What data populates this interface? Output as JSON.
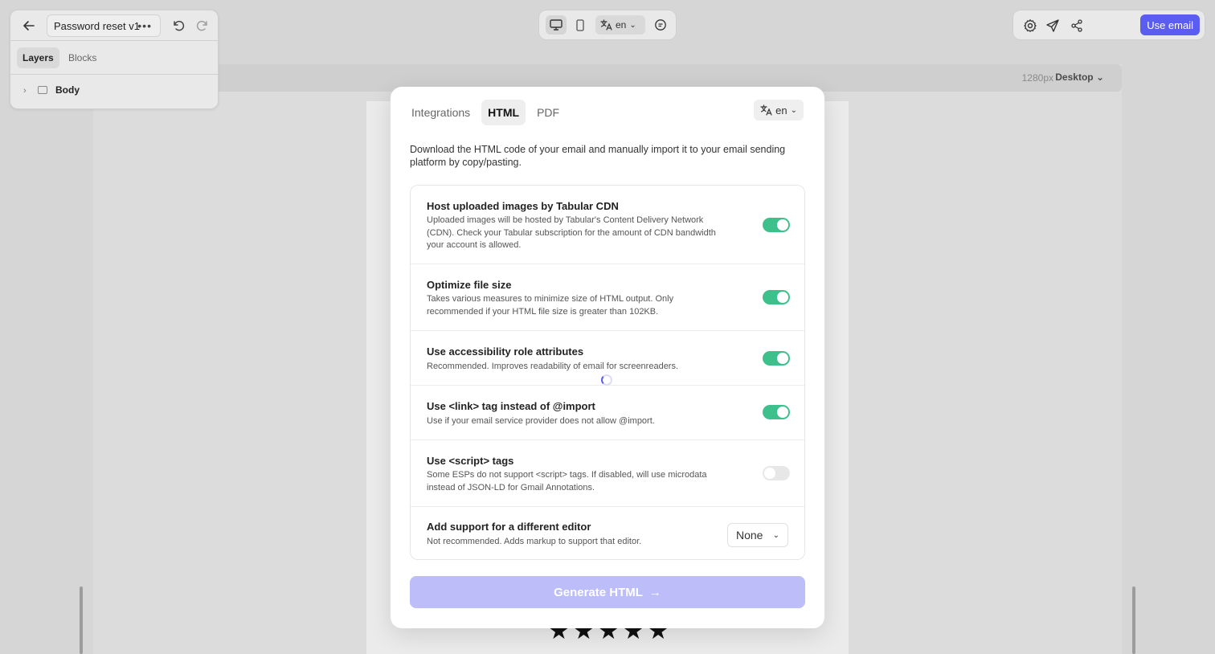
{
  "app": {
    "document_name": "Password reset v1",
    "left_tabs": [
      "Layers",
      "Blocks"
    ],
    "tree": {
      "root_label": "Body"
    },
    "language": "en",
    "use_email_label": "Use email"
  },
  "canvas": {
    "resolution": "1280px",
    "device": "Desktop",
    "rating_stars": "★★★★★"
  },
  "modal": {
    "tabs": [
      "Integrations",
      "HTML",
      "PDF"
    ],
    "active_tab": "HTML",
    "language": "en",
    "description": "Download the HTML code of your email and manually import it to your email sending platform by copy/pasting.",
    "options": [
      {
        "title": "Host uploaded images by Tabular CDN",
        "desc": "Uploaded images will be hosted by Tabular's Content Delivery Network (CDN). Check your Tabular subscription for the amount of CDN bandwidth your account is allowed.",
        "enabled": true
      },
      {
        "title": "Optimize file size",
        "desc": "Takes various measures to minimize size of HTML output. Only recommended if your HTML file size is greater than 102KB.",
        "enabled": true
      },
      {
        "title": "Use accessibility role attributes",
        "desc": "Recommended. Improves readability of email for screenreaders.",
        "enabled": true
      },
      {
        "title": "Use <link> tag instead of @import",
        "desc": "Use if your email service provider does not allow @import.",
        "enabled": true
      },
      {
        "title": "Use <script> tags",
        "desc": "Some ESPs do not support <script> tags. If disabled, will use microdata instead of JSON-LD for Gmail Annotations.",
        "enabled": false
      },
      {
        "title": "Add support for a different editor",
        "desc": "Not recommended. Adds markup to support that editor.",
        "select_value": "None"
      }
    ],
    "generate_label": "Generate HTML",
    "generate_arrow": "→"
  },
  "colors": {
    "accent": "#5b5cf0",
    "toggle_on": "#3ec08d",
    "generate_disabled": "#bdbdfa"
  }
}
